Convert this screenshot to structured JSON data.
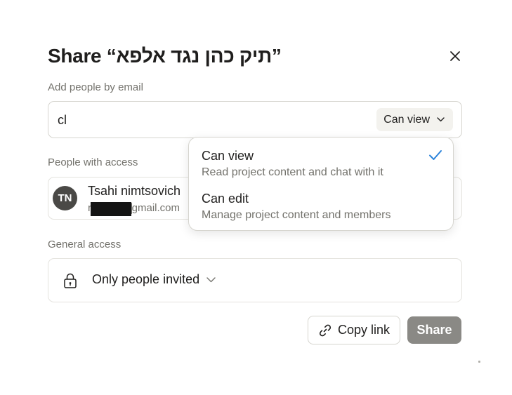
{
  "dialog": {
    "title": "Share “תיק כהן נגד אלפא”",
    "close_icon": "close-icon"
  },
  "add_people": {
    "label": "Add people by email",
    "input_value": "cl",
    "permission": "Can view"
  },
  "people_with_access": {
    "label": "People with access",
    "people": [
      {
        "initials": "TN",
        "name": "Tsahi nimtsovich",
        "email": "r▇▇▇▇▇gmail.com"
      }
    ]
  },
  "general_access": {
    "label": "General access",
    "value": "Only people invited"
  },
  "footer": {
    "copy_link_label": "Copy link",
    "share_label": "Share"
  },
  "permission_dropdown": {
    "options": [
      {
        "label": "Can view",
        "description": "Read project content and chat with it",
        "selected": true
      },
      {
        "label": "Can edit",
        "description": "Manage project content and members",
        "selected": false
      }
    ]
  },
  "colors": {
    "accent_check": "#2c84db",
    "share_button_disabled": "#8a8985",
    "text_primary": "#1f1e1d",
    "text_secondary": "#73726c",
    "border": "#d6d5cf"
  }
}
